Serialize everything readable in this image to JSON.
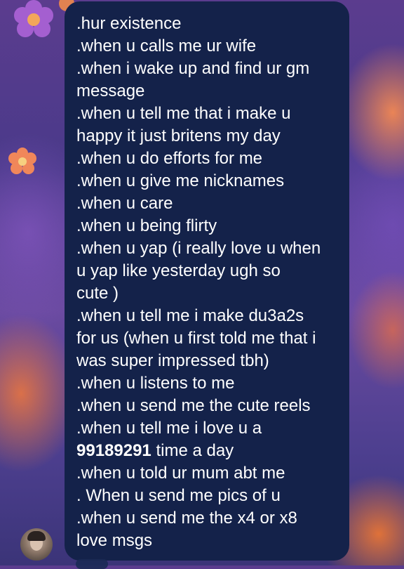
{
  "message": {
    "lines": [
      ".hur existence",
      ".when u calls me ur wife",
      ".when i wake up and find ur gm",
      "message",
      ".when u tell me that i make u",
      "happy it just britens my day",
      ".when u do efforts for me",
      ".when u give me nicknames",
      ".when u care",
      ".when u being flirty",
      ".when u yap (i really love u when",
      "u yap like yesterday ugh so",
      "cute )",
      ".when u tell me i make du3a2s",
      "for us (when u first told me that i",
      "was super impressed tbh)",
      ".when u listens to me",
      ".when u send me the cute reels",
      ".when u tell me i love u a"
    ],
    "bold_number": "99189291",
    "bold_suffix": " time a day",
    "lines_after": [
      ".when u told ur mum abt me",
      ". When u send me pics of u",
      ".when u send me the x4 or x8",
      "love msgs"
    ]
  },
  "colors": {
    "bubble": "#14224a",
    "text": "#ffffff",
    "background": "#4a3a8a",
    "flower_orange": "#f0875a",
    "flower_purple": "#a45fd0"
  },
  "icons": {
    "sender_avatar": "avatar",
    "decor_1": "flower-icon",
    "decor_2": "flower-icon"
  }
}
